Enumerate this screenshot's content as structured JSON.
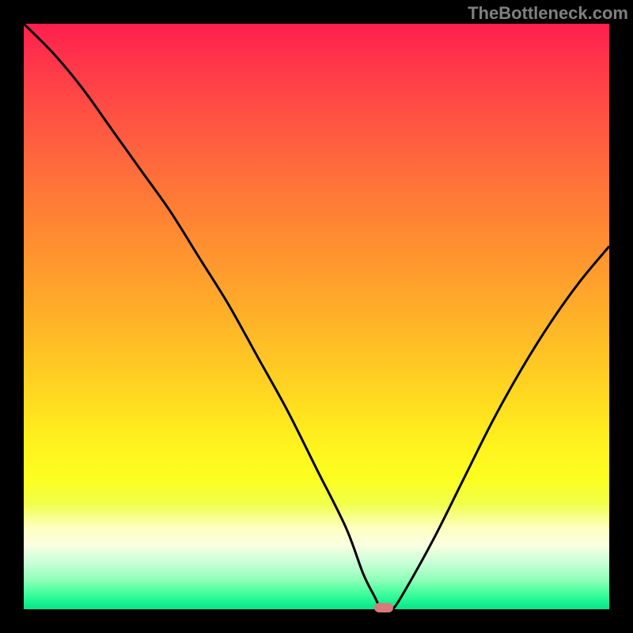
{
  "watermark": "TheBottleneck.com",
  "chart_data": {
    "type": "line",
    "title": "",
    "xlabel": "",
    "ylabel": "",
    "xlim": [
      0,
      100
    ],
    "ylim": [
      0,
      100
    ],
    "grid": false,
    "series": [
      {
        "name": "bottleneck-curve",
        "x": [
          0,
          5,
          10,
          15,
          20,
          25,
          30,
          35,
          40,
          45,
          50,
          55,
          58,
          60,
          61,
          62,
          63,
          65,
          70,
          75,
          80,
          85,
          90,
          95,
          100
        ],
        "values": [
          100,
          95,
          89,
          82,
          75,
          68,
          60,
          52,
          43,
          34,
          24,
          14,
          6,
          2,
          0,
          0,
          0,
          3,
          12,
          22,
          32,
          41,
          49,
          56,
          62
        ],
        "color": "#000000"
      }
    ],
    "optimal_marker": {
      "x": 61.5,
      "y": 0,
      "color": "#d87a7a"
    },
    "background_gradient": {
      "top_color": "#ff1f4e",
      "mid_color": "#ffe01f",
      "bottom_color": "#0ee088"
    }
  }
}
